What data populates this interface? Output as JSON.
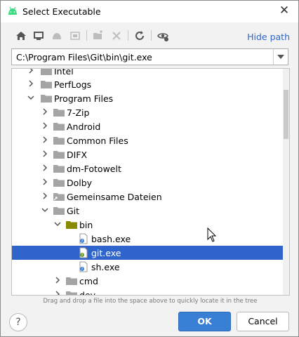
{
  "window": {
    "title": "Select Executable",
    "close_glyph": "✕"
  },
  "toolbar": {
    "icons": [
      "home-icon",
      "desktop-icon",
      "android-icon",
      "module-icon",
      "new-folder-icon",
      "delete-icon",
      "refresh-icon",
      "show-hidden-icon"
    ],
    "hide_path_label": "Hide path"
  },
  "path_field": {
    "value": "C:\\Program Files\\Git\\bin\\git.exe"
  },
  "tree": {
    "items": [
      {
        "label": "Intel",
        "type": "folder",
        "level": 1,
        "state": "collapsed"
      },
      {
        "label": "PerfLogs",
        "type": "folder",
        "level": 1,
        "state": "collapsed"
      },
      {
        "label": "Program Files",
        "type": "folder",
        "level": 1,
        "state": "expanded"
      },
      {
        "label": "7-Zip",
        "type": "folder",
        "level": 2,
        "state": "collapsed"
      },
      {
        "label": "Android",
        "type": "folder",
        "level": 2,
        "state": "collapsed"
      },
      {
        "label": "Common Files",
        "type": "folder",
        "level": 2,
        "state": "collapsed"
      },
      {
        "label": "DIFX",
        "type": "folder",
        "level": 2,
        "state": "collapsed"
      },
      {
        "label": "dm-Fotowelt",
        "type": "folder",
        "level": 2,
        "state": "collapsed"
      },
      {
        "label": "Dolby",
        "type": "folder",
        "level": 2,
        "state": "collapsed"
      },
      {
        "label": "Gemeinsame Dateien",
        "type": "shortcut-folder",
        "level": 2,
        "state": "collapsed"
      },
      {
        "label": "Git",
        "type": "folder",
        "level": 2,
        "state": "expanded"
      },
      {
        "label": "bin",
        "type": "folder",
        "level": 3,
        "state": "expanded"
      },
      {
        "label": "bash.exe",
        "type": "file",
        "level": 4
      },
      {
        "label": "git.exe",
        "type": "file",
        "level": 4,
        "selected": true
      },
      {
        "label": "sh.exe",
        "type": "file",
        "level": 4
      },
      {
        "label": "cmd",
        "type": "folder",
        "level": 3,
        "state": "collapsed"
      },
      {
        "label": "dev",
        "type": "folder",
        "level": 3,
        "state": "collapsed"
      }
    ]
  },
  "hint": "Drag and drop a file into the space above to quickly locate it in the tree",
  "footer": {
    "help_label": "?",
    "ok_label": "OK",
    "cancel_label": "Cancel"
  },
  "colors": {
    "accent": "#2f65ca",
    "highlight_yellow": "#f7f41a",
    "highlight_green": "#aabb1a",
    "folder": "#a4a4a4"
  }
}
